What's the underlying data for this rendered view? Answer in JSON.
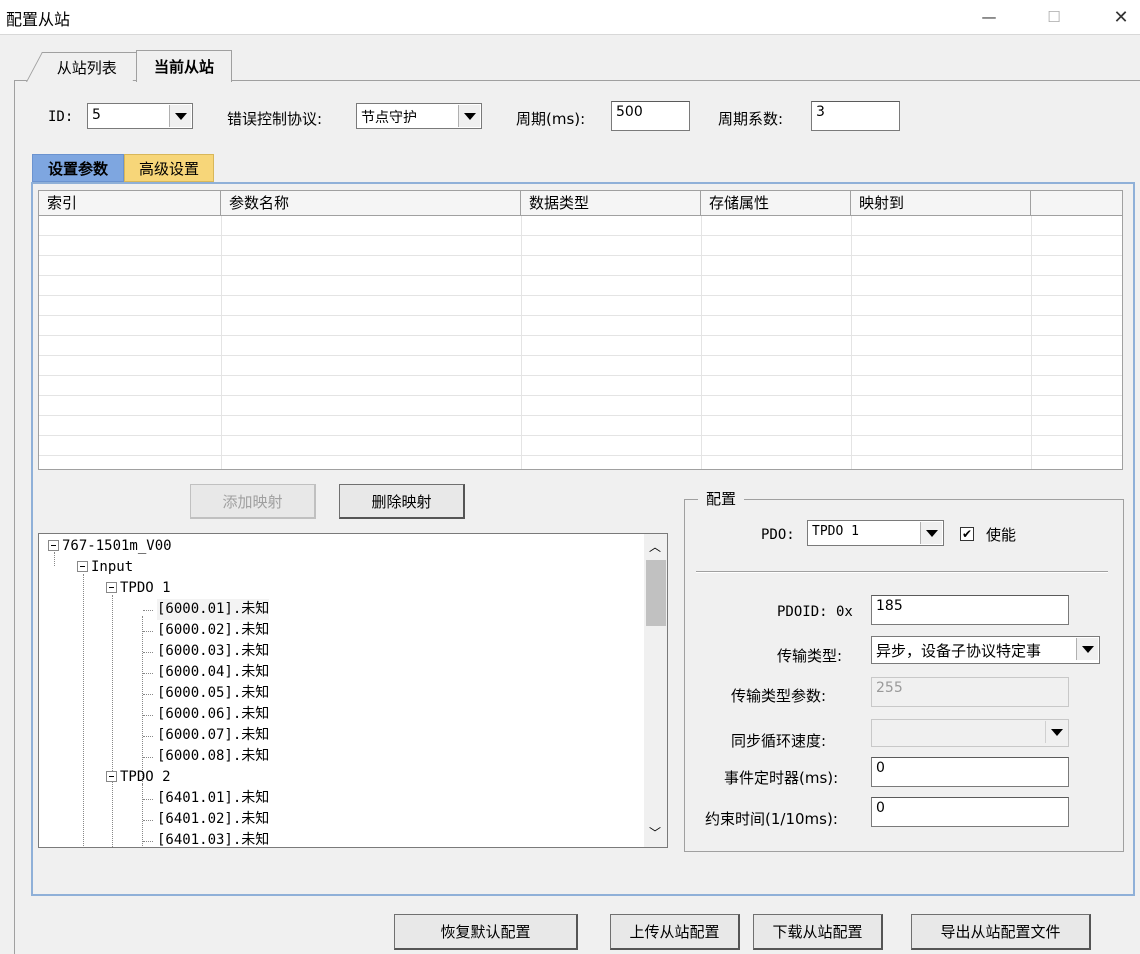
{
  "window": {
    "title": "配置从站",
    "minimize": "—",
    "maximize": "☐",
    "close": "✕"
  },
  "tabs": [
    {
      "label": "从站列表"
    },
    {
      "label": "当前从站"
    }
  ],
  "top": {
    "id_label": "ID:",
    "id_value": "5",
    "protocol_label": "错误控制协议:",
    "protocol_value": "节点守护",
    "period_label": "周期(ms):",
    "period_value": "500",
    "factor_label": "周期系数:",
    "factor_value": "3"
  },
  "inner_tabs": [
    {
      "label": "设置参数"
    },
    {
      "label": "高级设置"
    }
  ],
  "grid": {
    "columns": [
      "索引",
      "参数名称",
      "数据类型",
      "存储属性",
      "映射到",
      ""
    ]
  },
  "buttons": {
    "add_mapping": "添加映射",
    "delete_mapping": "删除映射",
    "restore": "恢复默认配置",
    "upload": "上传从站配置",
    "download": "下载从站配置",
    "export": "导出从站配置文件"
  },
  "tree": {
    "root": "767-1501m_V00",
    "input": "Input",
    "tpdo1": "TPDO 1",
    "tpdo1_items": [
      "[6000.01].未知",
      "[6000.02].未知",
      "[6000.03].未知",
      "[6000.04].未知",
      "[6000.05].未知",
      "[6000.06].未知",
      "[6000.07].未知",
      "[6000.08].未知"
    ],
    "tpdo2": "TPDO 2",
    "tpdo2_items": [
      "[6401.01].未知",
      "[6401.02].未知",
      "[6401.03].未知"
    ]
  },
  "config": {
    "title": "配置",
    "pdo_label": "PDO:",
    "pdo_value": "TPDO 1",
    "enable_label": "使能",
    "enable_checked": "✔",
    "pdoid_label": "PDOID: 0x",
    "pdoid_value": "185",
    "trans_type_label": "传输类型:",
    "trans_type_value": "异步，设备子协议特定事",
    "trans_param_label": "传输类型参数:",
    "trans_param_value": "255",
    "sync_speed_label": "同步循环速度:",
    "sync_speed_value": "",
    "event_timer_label": "事件定时器(ms):",
    "event_timer_value": "0",
    "inhibit_label": "约束时间(1/10ms):",
    "inhibit_value": "0"
  }
}
